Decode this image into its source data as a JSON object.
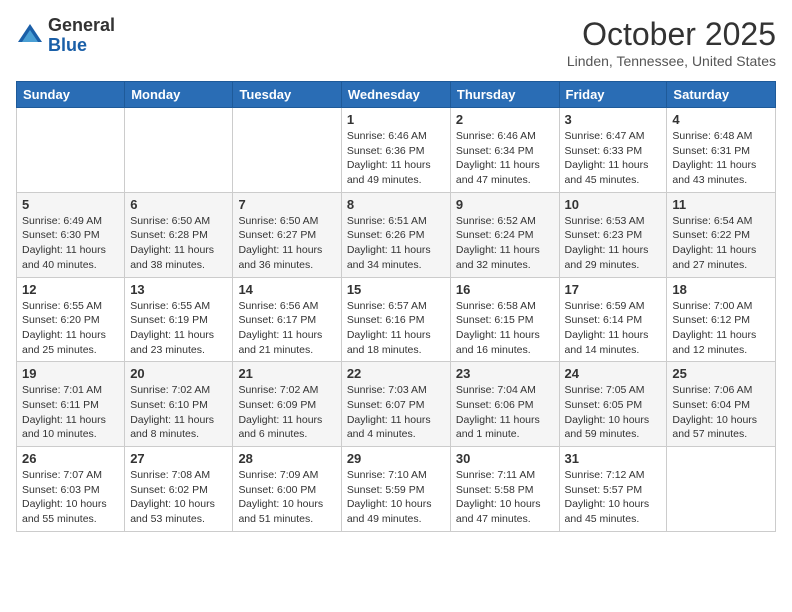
{
  "header": {
    "logo_general": "General",
    "logo_blue": "Blue",
    "month": "October 2025",
    "location": "Linden, Tennessee, United States"
  },
  "weekdays": [
    "Sunday",
    "Monday",
    "Tuesday",
    "Wednesday",
    "Thursday",
    "Friday",
    "Saturday"
  ],
  "weeks": [
    [
      {
        "day": "",
        "info": ""
      },
      {
        "day": "",
        "info": ""
      },
      {
        "day": "",
        "info": ""
      },
      {
        "day": "1",
        "info": "Sunrise: 6:46 AM\nSunset: 6:36 PM\nDaylight: 11 hours and 49 minutes."
      },
      {
        "day": "2",
        "info": "Sunrise: 6:46 AM\nSunset: 6:34 PM\nDaylight: 11 hours and 47 minutes."
      },
      {
        "day": "3",
        "info": "Sunrise: 6:47 AM\nSunset: 6:33 PM\nDaylight: 11 hours and 45 minutes."
      },
      {
        "day": "4",
        "info": "Sunrise: 6:48 AM\nSunset: 6:31 PM\nDaylight: 11 hours and 43 minutes."
      }
    ],
    [
      {
        "day": "5",
        "info": "Sunrise: 6:49 AM\nSunset: 6:30 PM\nDaylight: 11 hours and 40 minutes."
      },
      {
        "day": "6",
        "info": "Sunrise: 6:50 AM\nSunset: 6:28 PM\nDaylight: 11 hours and 38 minutes."
      },
      {
        "day": "7",
        "info": "Sunrise: 6:50 AM\nSunset: 6:27 PM\nDaylight: 11 hours and 36 minutes."
      },
      {
        "day": "8",
        "info": "Sunrise: 6:51 AM\nSunset: 6:26 PM\nDaylight: 11 hours and 34 minutes."
      },
      {
        "day": "9",
        "info": "Sunrise: 6:52 AM\nSunset: 6:24 PM\nDaylight: 11 hours and 32 minutes."
      },
      {
        "day": "10",
        "info": "Sunrise: 6:53 AM\nSunset: 6:23 PM\nDaylight: 11 hours and 29 minutes."
      },
      {
        "day": "11",
        "info": "Sunrise: 6:54 AM\nSunset: 6:22 PM\nDaylight: 11 hours and 27 minutes."
      }
    ],
    [
      {
        "day": "12",
        "info": "Sunrise: 6:55 AM\nSunset: 6:20 PM\nDaylight: 11 hours and 25 minutes."
      },
      {
        "day": "13",
        "info": "Sunrise: 6:55 AM\nSunset: 6:19 PM\nDaylight: 11 hours and 23 minutes."
      },
      {
        "day": "14",
        "info": "Sunrise: 6:56 AM\nSunset: 6:17 PM\nDaylight: 11 hours and 21 minutes."
      },
      {
        "day": "15",
        "info": "Sunrise: 6:57 AM\nSunset: 6:16 PM\nDaylight: 11 hours and 18 minutes."
      },
      {
        "day": "16",
        "info": "Sunrise: 6:58 AM\nSunset: 6:15 PM\nDaylight: 11 hours and 16 minutes."
      },
      {
        "day": "17",
        "info": "Sunrise: 6:59 AM\nSunset: 6:14 PM\nDaylight: 11 hours and 14 minutes."
      },
      {
        "day": "18",
        "info": "Sunrise: 7:00 AM\nSunset: 6:12 PM\nDaylight: 11 hours and 12 minutes."
      }
    ],
    [
      {
        "day": "19",
        "info": "Sunrise: 7:01 AM\nSunset: 6:11 PM\nDaylight: 11 hours and 10 minutes."
      },
      {
        "day": "20",
        "info": "Sunrise: 7:02 AM\nSunset: 6:10 PM\nDaylight: 11 hours and 8 minutes."
      },
      {
        "day": "21",
        "info": "Sunrise: 7:02 AM\nSunset: 6:09 PM\nDaylight: 11 hours and 6 minutes."
      },
      {
        "day": "22",
        "info": "Sunrise: 7:03 AM\nSunset: 6:07 PM\nDaylight: 11 hours and 4 minutes."
      },
      {
        "day": "23",
        "info": "Sunrise: 7:04 AM\nSunset: 6:06 PM\nDaylight: 11 hours and 1 minute."
      },
      {
        "day": "24",
        "info": "Sunrise: 7:05 AM\nSunset: 6:05 PM\nDaylight: 10 hours and 59 minutes."
      },
      {
        "day": "25",
        "info": "Sunrise: 7:06 AM\nSunset: 6:04 PM\nDaylight: 10 hours and 57 minutes."
      }
    ],
    [
      {
        "day": "26",
        "info": "Sunrise: 7:07 AM\nSunset: 6:03 PM\nDaylight: 10 hours and 55 minutes."
      },
      {
        "day": "27",
        "info": "Sunrise: 7:08 AM\nSunset: 6:02 PM\nDaylight: 10 hours and 53 minutes."
      },
      {
        "day": "28",
        "info": "Sunrise: 7:09 AM\nSunset: 6:00 PM\nDaylight: 10 hours and 51 minutes."
      },
      {
        "day": "29",
        "info": "Sunrise: 7:10 AM\nSunset: 5:59 PM\nDaylight: 10 hours and 49 minutes."
      },
      {
        "day": "30",
        "info": "Sunrise: 7:11 AM\nSunset: 5:58 PM\nDaylight: 10 hours and 47 minutes."
      },
      {
        "day": "31",
        "info": "Sunrise: 7:12 AM\nSunset: 5:57 PM\nDaylight: 10 hours and 45 minutes."
      },
      {
        "day": "",
        "info": ""
      }
    ]
  ]
}
